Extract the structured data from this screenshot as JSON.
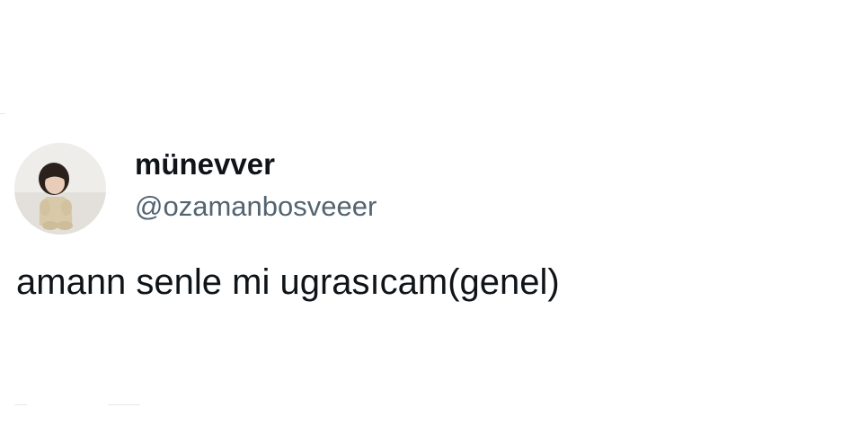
{
  "tweet": {
    "author": {
      "display_name": "münevver",
      "handle": "@ozamanbosveeer",
      "avatar_icon": "profile-photo-baby-sitting"
    },
    "text": "amann senle mi ugrasıcam(genel)"
  },
  "colors": {
    "background": "#ffffff",
    "primary_text": "#0f1419",
    "secondary_text": "#536471"
  }
}
